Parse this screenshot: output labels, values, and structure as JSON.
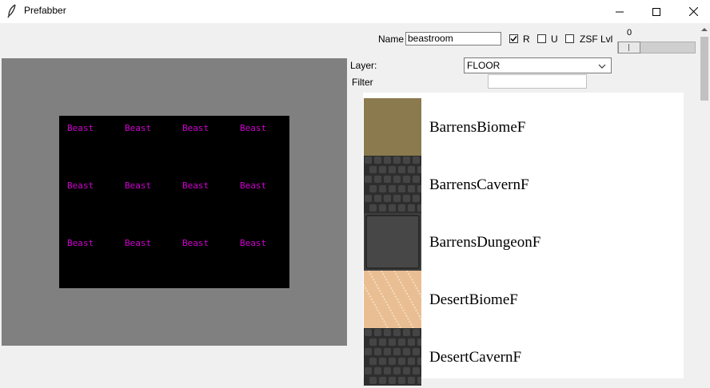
{
  "window": {
    "title": "Prefabber",
    "icon": "feather-icon",
    "controls": [
      "minimize-icon",
      "maximize-icon",
      "close-icon"
    ]
  },
  "toolbar": {
    "name_label": "Name",
    "name_value": "beastroom",
    "checkboxes": [
      {
        "label": "R",
        "checked": true
      },
      {
        "label": "U",
        "checked": false
      },
      {
        "label": "ZSF",
        "checked": false
      }
    ],
    "lvl_label": "Lvl",
    "slider_value": "0"
  },
  "layer": {
    "label": "Layer:",
    "value": "FLOOR"
  },
  "filter": {
    "label": "Filter",
    "value": ""
  },
  "canvas": {
    "background": "#808080",
    "room_color": "#000000",
    "cell_text_color": "#d000d0",
    "cells": [
      [
        "Beast",
        "Beast",
        "Beast",
        "Beast"
      ],
      [
        "Beast",
        "Beast",
        "Beast",
        "Beast"
      ],
      [
        "Beast",
        "Beast",
        "Beast",
        "Beast"
      ]
    ]
  },
  "tiles": [
    {
      "name": "BarrensBiomeF",
      "color": "#8b7a4e",
      "pattern": "plain"
    },
    {
      "name": "BarrensCavernF",
      "color": "#2e2e2e",
      "pattern": "cobble"
    },
    {
      "name": "BarrensDungeonF",
      "color": "#3f3f3f",
      "pattern": "block"
    },
    {
      "name": "DesertBiomeF",
      "color": "#e9be93",
      "pattern": "sand"
    },
    {
      "name": "DesertCavernF",
      "color": "#2e2e2e",
      "pattern": "cobble"
    }
  ]
}
